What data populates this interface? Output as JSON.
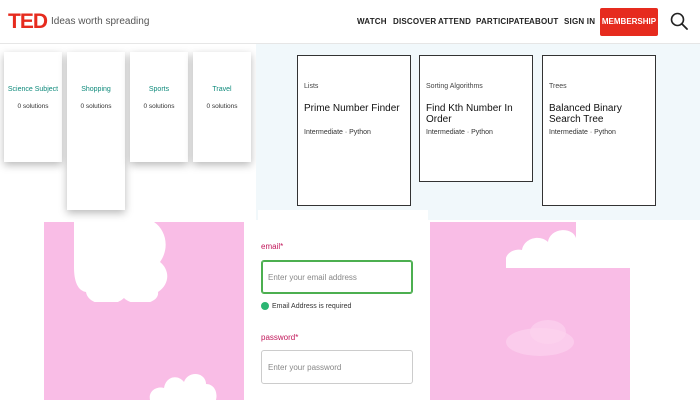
{
  "header": {
    "logo": "TED",
    "tagline": "Ideas worth spreading",
    "nav": [
      "WATCH",
      "DISCOVER",
      "ATTEND",
      "PARTICIPATE",
      "ABOUT",
      "SIGN IN"
    ],
    "membership_label": "MEMBERSHIP"
  },
  "categories": [
    {
      "name": "Science Subject",
      "count": "0 solutions"
    },
    {
      "name": "Shopping",
      "count": "0 solutions"
    },
    {
      "name": "Sports",
      "count": "0 solutions"
    },
    {
      "name": "Travel",
      "count": "0 solutions"
    }
  ],
  "problems": [
    {
      "topic": "Lists",
      "title": "Prime Number Finder",
      "meta": "Intermediate · Python"
    },
    {
      "topic": "Sorting Algorithms",
      "title": "Find Kth Number In Order",
      "meta": "Intermediate · Python"
    },
    {
      "topic": "Trees",
      "title": "Balanced Binary Search Tree",
      "meta": "Intermediate · Python"
    }
  ],
  "form": {
    "email_label": "email*",
    "email_placeholder": "Enter your email address",
    "email_error": "Email Address is required",
    "password_label": "password*",
    "password_placeholder": "Enter your password"
  },
  "colors": {
    "accent": "#e62b1e",
    "pink": "#f9bde6",
    "category_text": "#0e8a7b",
    "form_label": "#c2185b"
  }
}
